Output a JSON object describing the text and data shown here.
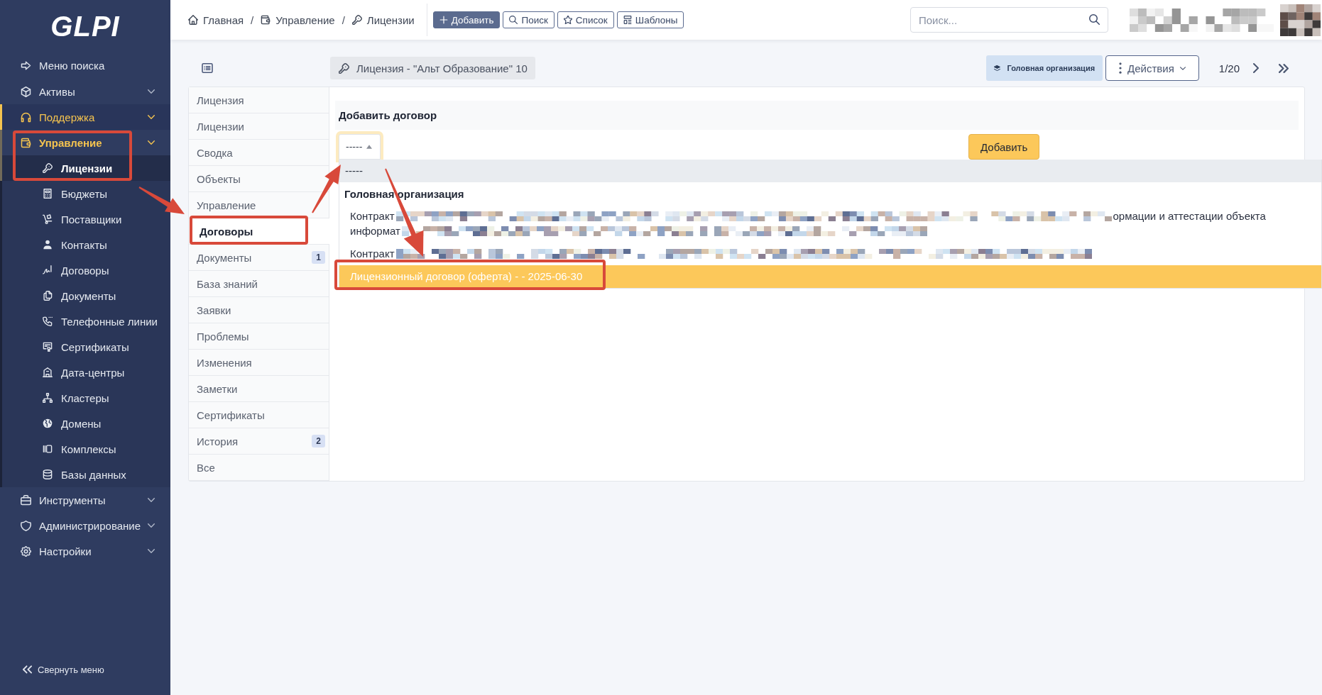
{
  "sidebar": {
    "logo": "GLPI",
    "items": [
      {
        "kind": "link",
        "label": "Меню поиска",
        "active": false,
        "hovered": false,
        "expanded": false
      },
      {
        "kind": "menu",
        "label": "Активы",
        "active": false,
        "hovered": false,
        "expanded": false
      },
      {
        "kind": "menu",
        "label": "Поддержка",
        "active": false,
        "hovered": true,
        "expanded": false
      },
      {
        "kind": "menu",
        "label": "Управление",
        "active": true,
        "hovered": false,
        "expanded": true,
        "children": [
          {
            "label": "Лицензии",
            "selected": true
          },
          {
            "label": "Бюджеты",
            "selected": false
          },
          {
            "label": "Поставщики",
            "selected": false
          },
          {
            "label": "Контакты",
            "selected": false
          },
          {
            "label": "Договоры",
            "selected": false
          },
          {
            "label": "Документы",
            "selected": false
          },
          {
            "label": "Телефонные линии",
            "selected": false
          },
          {
            "label": "Сертификаты",
            "selected": false
          },
          {
            "label": "Дата-центры",
            "selected": false
          },
          {
            "label": "Кластеры",
            "selected": false
          },
          {
            "label": "Домены",
            "selected": false
          },
          {
            "label": "Комплексы",
            "selected": false
          },
          {
            "label": "Базы данных",
            "selected": false
          }
        ]
      },
      {
        "kind": "menu",
        "label": "Инструменты",
        "active": false,
        "hovered": false,
        "expanded": false
      },
      {
        "kind": "menu",
        "label": "Администрирование",
        "active": false,
        "hovered": false,
        "expanded": false
      },
      {
        "kind": "menu",
        "label": "Настройки",
        "active": false,
        "hovered": false,
        "expanded": false
      }
    ],
    "collapse": "Свернуть меню"
  },
  "topbar": {
    "breadcrumbs": [
      {
        "label": "Главная"
      },
      {
        "separator": "/",
        "label": "Управление"
      },
      {
        "separator": "/",
        "label": "Лицензии"
      }
    ],
    "buttons": [
      {
        "kind": "primary",
        "label": "Добавить"
      },
      {
        "kind": "outline",
        "label": "Поиск"
      },
      {
        "kind": "outline",
        "label": "Список"
      },
      {
        "kind": "outline",
        "label": "Шаблоны"
      }
    ],
    "search": {
      "placeholder": "Поиск..."
    }
  },
  "header": {
    "title": "Лицензия - \"Альт Образование\" 10",
    "entity": "Головная организация",
    "actions": "Действия",
    "pager": "1/20"
  },
  "tabs": [
    {
      "label": "Лицензия",
      "selected": false
    },
    {
      "label": "Лицензии",
      "selected": false
    },
    {
      "label": "Сводка",
      "selected": false
    },
    {
      "label": "Объекты",
      "selected": false
    },
    {
      "label": "Управление",
      "selected": false
    },
    {
      "label": "Договоры",
      "selected": true
    },
    {
      "label": "Документы",
      "selected": false,
      "badge": "1"
    },
    {
      "label": "База знаний",
      "selected": false
    },
    {
      "label": "Заявки",
      "selected": false
    },
    {
      "label": "Проблемы",
      "selected": false
    },
    {
      "label": "Изменения",
      "selected": false
    },
    {
      "label": "Заметки",
      "selected": false
    },
    {
      "label": "Сертификаты",
      "selected": false
    },
    {
      "label": "История",
      "selected": false,
      "badge": "2"
    },
    {
      "label": "Все",
      "selected": false
    }
  ],
  "panel": {
    "heading": "Добавить договор",
    "select": {
      "value": "-----",
      "open": true,
      "options": [
        {
          "kind": "option",
          "selected": true,
          "highlighted": false,
          "lines": [
            {
              "text": "-----",
              "redacted": false
            }
          ]
        },
        {
          "kind": "group",
          "label": "Головная организация",
          "options": [
            {
              "kind": "option",
              "selected": false,
              "highlighted": false,
              "lines": [
                {
                  "text": "Контракт",
                  "redacted": true,
                  "after": "ормации и аттестации объекта"
                },
                {
                  "text": "информат",
                  "redacted": true
                }
              ]
            },
            {
              "kind": "option",
              "selected": false,
              "highlighted": false,
              "lines": [
                {
                  "text": "Контракт",
                  "redacted": true
                }
              ]
            },
            {
              "kind": "option",
              "selected": false,
              "highlighted": true,
              "lines": [
                {
                  "text": "Лицензионный договор (оферта) - - 2025-06-30",
                  "redacted": false
                }
              ]
            }
          ]
        }
      ]
    },
    "add_button": "Добавить"
  }
}
